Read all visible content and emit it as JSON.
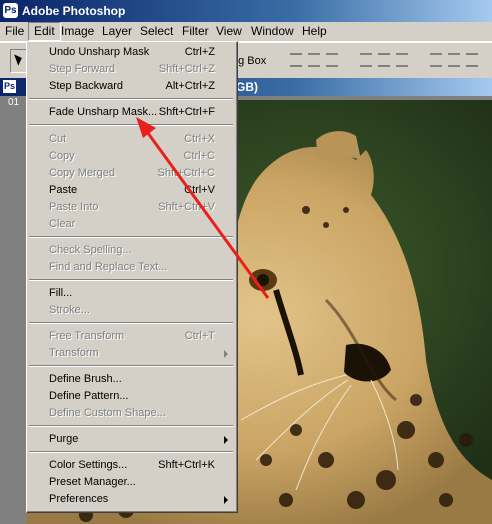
{
  "app": {
    "title": "Adobe Photoshop"
  },
  "menubar": {
    "items": [
      "File",
      "Edit",
      "Image",
      "Layer",
      "Select",
      "Filter",
      "View",
      "Window",
      "Help"
    ]
  },
  "options_bar": {
    "bounding_box_label": "ng Box"
  },
  "document": {
    "title_fragment": "GB)",
    "ruler_label": "01"
  },
  "edit_menu": {
    "items": [
      {
        "label": "Undo Unsharp Mask",
        "shortcut": "Ctrl+Z",
        "enabled": true
      },
      {
        "label": "Step Forward",
        "shortcut": "Shft+Ctrl+Z",
        "enabled": false
      },
      {
        "label": "Step Backward",
        "shortcut": "Alt+Ctrl+Z",
        "enabled": true
      },
      {
        "label": "Fade Unsharp Mask...",
        "shortcut": "Shft+Ctrl+F",
        "enabled": true
      },
      {
        "label": "Cut",
        "shortcut": "Ctrl+X",
        "enabled": false
      },
      {
        "label": "Copy",
        "shortcut": "Ctrl+C",
        "enabled": false
      },
      {
        "label": "Copy Merged",
        "shortcut": "Shft+Ctrl+C",
        "enabled": false
      },
      {
        "label": "Paste",
        "shortcut": "Ctrl+V",
        "enabled": true
      },
      {
        "label": "Paste Into",
        "shortcut": "Shft+Ctrl+V",
        "enabled": false
      },
      {
        "label": "Clear",
        "shortcut": "",
        "enabled": false
      },
      {
        "label": "Check Spelling...",
        "shortcut": "",
        "enabled": false
      },
      {
        "label": "Find and Replace Text...",
        "shortcut": "",
        "enabled": false
      },
      {
        "label": "Fill...",
        "shortcut": "",
        "enabled": true
      },
      {
        "label": "Stroke...",
        "shortcut": "",
        "enabled": false
      },
      {
        "label": "Free Transform",
        "shortcut": "Ctrl+T",
        "enabled": false
      },
      {
        "label": "Transform",
        "shortcut": "",
        "enabled": false,
        "submenu": true
      },
      {
        "label": "Define Brush...",
        "shortcut": "",
        "enabled": true
      },
      {
        "label": "Define Pattern...",
        "shortcut": "",
        "enabled": true
      },
      {
        "label": "Define Custom Shape...",
        "shortcut": "",
        "enabled": false
      },
      {
        "label": "Purge",
        "shortcut": "",
        "enabled": true,
        "submenu": true
      },
      {
        "label": "Color Settings...",
        "shortcut": "Shft+Ctrl+K",
        "enabled": true
      },
      {
        "label": "Preset Manager...",
        "shortcut": "",
        "enabled": true
      },
      {
        "label": "Preferences",
        "shortcut": "",
        "enabled": true,
        "submenu": true
      }
    ]
  },
  "colors": {
    "titlebar": "#0a246a",
    "menu_bg": "#d4d0c8",
    "annotation_arrow": "#e8201c"
  }
}
